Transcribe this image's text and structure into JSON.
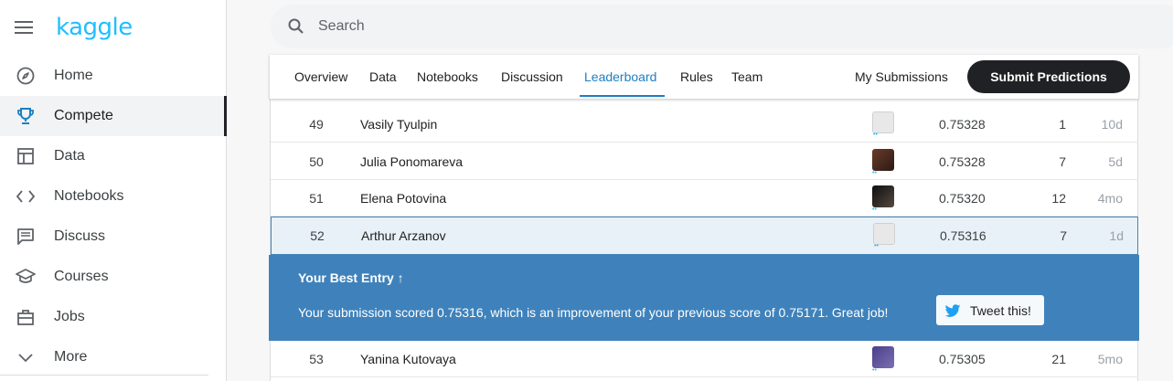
{
  "brand": {
    "logo_text": "kaggle",
    "color": "#20beff"
  },
  "sidebar": {
    "items": [
      {
        "label": "Home",
        "icon": "compass-icon"
      },
      {
        "label": "Compete",
        "icon": "trophy-icon",
        "active": true
      },
      {
        "label": "Data",
        "icon": "table-icon"
      },
      {
        "label": "Notebooks",
        "icon": "code-icon"
      },
      {
        "label": "Discuss",
        "icon": "comment-icon"
      },
      {
        "label": "Courses",
        "icon": "graduation-cap-icon"
      },
      {
        "label": "Jobs",
        "icon": "briefcase-icon"
      },
      {
        "label": "More",
        "icon": "chevron-down-icon"
      }
    ]
  },
  "search": {
    "placeholder": "Search"
  },
  "tabs": {
    "items": [
      "Overview",
      "Data",
      "Notebooks",
      "Discussion",
      "Leaderboard",
      "Rules",
      "Team"
    ],
    "active": "Leaderboard",
    "my_submissions": "My Submissions",
    "submit_label": "Submit Predictions"
  },
  "leaderboard": {
    "rows": [
      {
        "rank": "49",
        "name": "Vasily Tyulpin",
        "score": "0.75328",
        "entries": "1",
        "last": "10d"
      },
      {
        "rank": "50",
        "name": "Julia Ponomareva",
        "score": "0.75328",
        "entries": "7",
        "last": "5d"
      },
      {
        "rank": "51",
        "name": "Elena Potovina",
        "score": "0.75320",
        "entries": "12",
        "last": "4mo"
      },
      {
        "rank": "52",
        "name": "Arthur Arzanov",
        "score": "0.75316",
        "entries": "7",
        "last": "1d"
      },
      {
        "rank": "53",
        "name": "Yanina Kutovaya",
        "score": "0.75305",
        "entries": "21",
        "last": "5mo"
      }
    ]
  },
  "banner": {
    "title": "Your Best Entry",
    "arrow": "↑",
    "message": "Your submission scored 0.75316, which is an improvement of your previous score of 0.75171. Great job!",
    "tweet_label": "Tweet this!",
    "color": "#3f82bb"
  },
  "tier_dots": "••"
}
